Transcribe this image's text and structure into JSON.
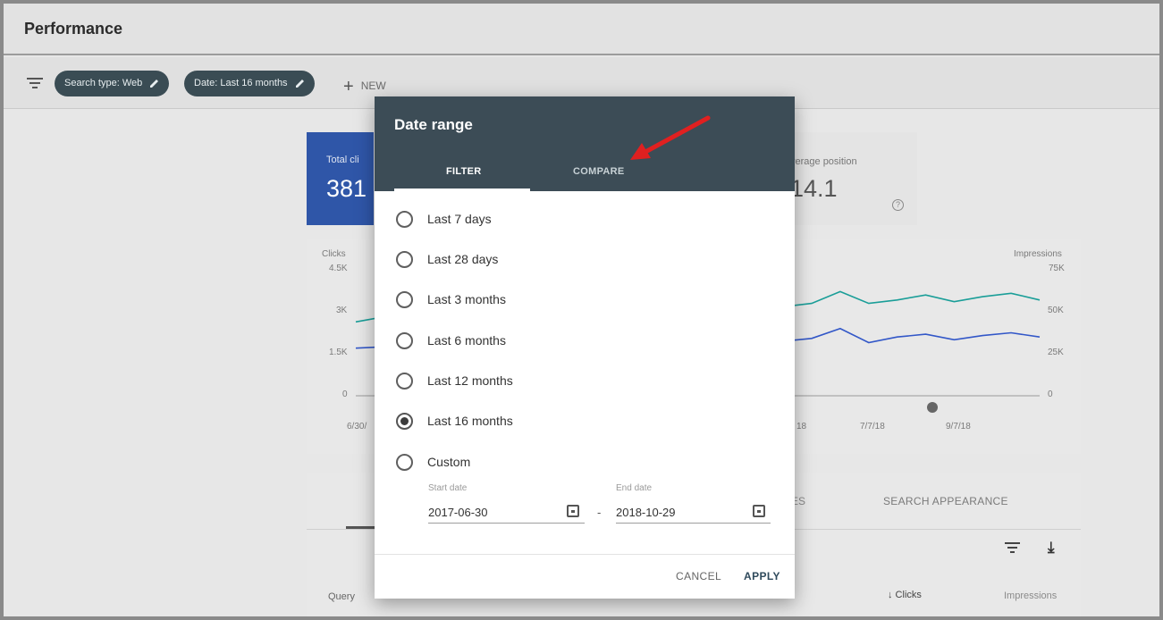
{
  "header": {
    "title": "Performance"
  },
  "filters": {
    "chips": [
      {
        "label": "Search type: Web"
      },
      {
        "label": "Date: Last 16 months"
      }
    ],
    "new_label": "NEW"
  },
  "stats": {
    "clicks_label": "Total cli",
    "clicks_value": "381",
    "position_label": "verage position",
    "position_value": "14.1",
    "help_glyph": "?"
  },
  "chart": {
    "left_axis_title": "Clicks",
    "right_axis_title": "Impressions",
    "left_ticks": [
      "4.5K",
      "3K",
      "1.5K",
      "0"
    ],
    "right_ticks": [
      "75K",
      "50K",
      "25K",
      "0"
    ],
    "x_labels": [
      "6/30/",
      "18",
      "7/7/18",
      "9/7/18"
    ],
    "colors": {
      "impressions": "#1a9e98",
      "clicks": "#3257c8"
    }
  },
  "chart_data": {
    "type": "line",
    "xlabel": "",
    "ylabel": "Clicks",
    "y2label": "Impressions",
    "ylim": [
      0,
      4500
    ],
    "y2lim": [
      0,
      75000
    ],
    "series": [
      {
        "name": "Clicks",
        "axis": "left",
        "values": [
          1700,
          1750,
          1650,
          1800,
          1700,
          1900,
          1750,
          1850,
          1800,
          2050,
          1850,
          2100,
          1900,
          2000,
          2300,
          1950,
          2050,
          2400,
          1900,
          2100,
          2200,
          2000,
          2150,
          2250,
          2100
        ]
      },
      {
        "name": "Impressions",
        "axis": "right",
        "values": [
          44000,
          47000,
          45000,
          48000,
          46000,
          50000,
          47000,
          49000,
          48000,
          52000,
          49000,
          54000,
          51000,
          53000,
          58000,
          53000,
          55000,
          62000,
          55000,
          57000,
          60000,
          56000,
          59000,
          61000,
          57000
        ]
      }
    ]
  },
  "dialog": {
    "title": "Date range",
    "tabs": [
      {
        "label": "FILTER"
      },
      {
        "label": "COMPARE"
      }
    ],
    "options": [
      {
        "label": "Last 7 days",
        "selected": false
      },
      {
        "label": "Last 28 days",
        "selected": false
      },
      {
        "label": "Last 3 months",
        "selected": false
      },
      {
        "label": "Last 6 months",
        "selected": false
      },
      {
        "label": "Last 12 months",
        "selected": false
      },
      {
        "label": "Last 16 months",
        "selected": true
      },
      {
        "label": "Custom",
        "selected": false
      }
    ],
    "start_date_label": "Start date",
    "start_date": "2017-06-30",
    "end_date_label": "End date",
    "end_date": "2018-10-29",
    "separator": "-",
    "cancel_label": "CANCEL",
    "apply_label": "APPLY"
  },
  "table": {
    "tab_es": "ES",
    "tab_search_appearance": "SEARCH APPEARANCE",
    "col_query": "Query",
    "col_clicks": "↓ Clicks",
    "col_impressions": "Impressions",
    "download_glyph": "⤓"
  },
  "annotation": {
    "arrow_color": "#e02020"
  }
}
